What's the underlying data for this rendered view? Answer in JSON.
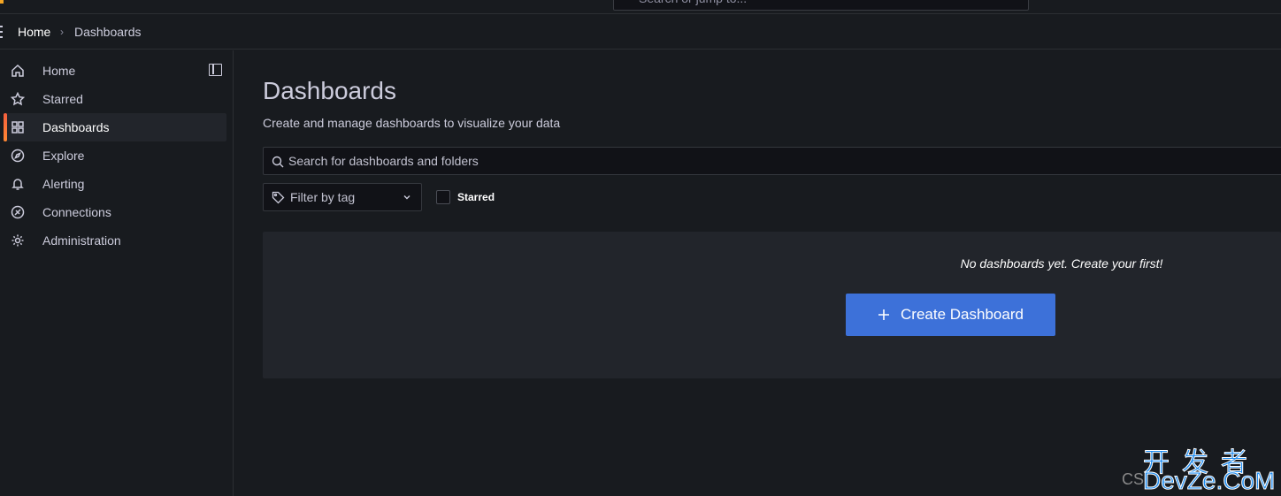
{
  "topbar": {
    "search_placeholder": "Search or jump to..."
  },
  "breadcrumb": {
    "home": "Home",
    "separator": "›",
    "current": "Dashboards"
  },
  "sidebar": {
    "items": [
      {
        "label": "Home",
        "icon": "home-icon"
      },
      {
        "label": "Starred",
        "icon": "star-icon"
      },
      {
        "label": "Dashboards",
        "icon": "apps-icon",
        "active": true
      },
      {
        "label": "Explore",
        "icon": "compass-icon"
      },
      {
        "label": "Alerting",
        "icon": "bell-icon"
      },
      {
        "label": "Connections",
        "icon": "connections-icon"
      },
      {
        "label": "Administration",
        "icon": "gear-icon"
      }
    ]
  },
  "main": {
    "title": "Dashboards",
    "subtitle": "Create and manage dashboards to visualize your data",
    "search_placeholder": "Search for dashboards and folders",
    "filter_tag": "Filter by tag",
    "starred_label": "Starred",
    "empty_message": "No dashboards yet. Create your first!",
    "create_button": "Create Dashboard"
  },
  "colors": {
    "accent": "#3d71d9",
    "active_bar": "#ff8833",
    "background": "#181b1f"
  },
  "watermark": {
    "cn": "开发者",
    "en": "DevZe.CoM",
    "prefix": "CS"
  }
}
